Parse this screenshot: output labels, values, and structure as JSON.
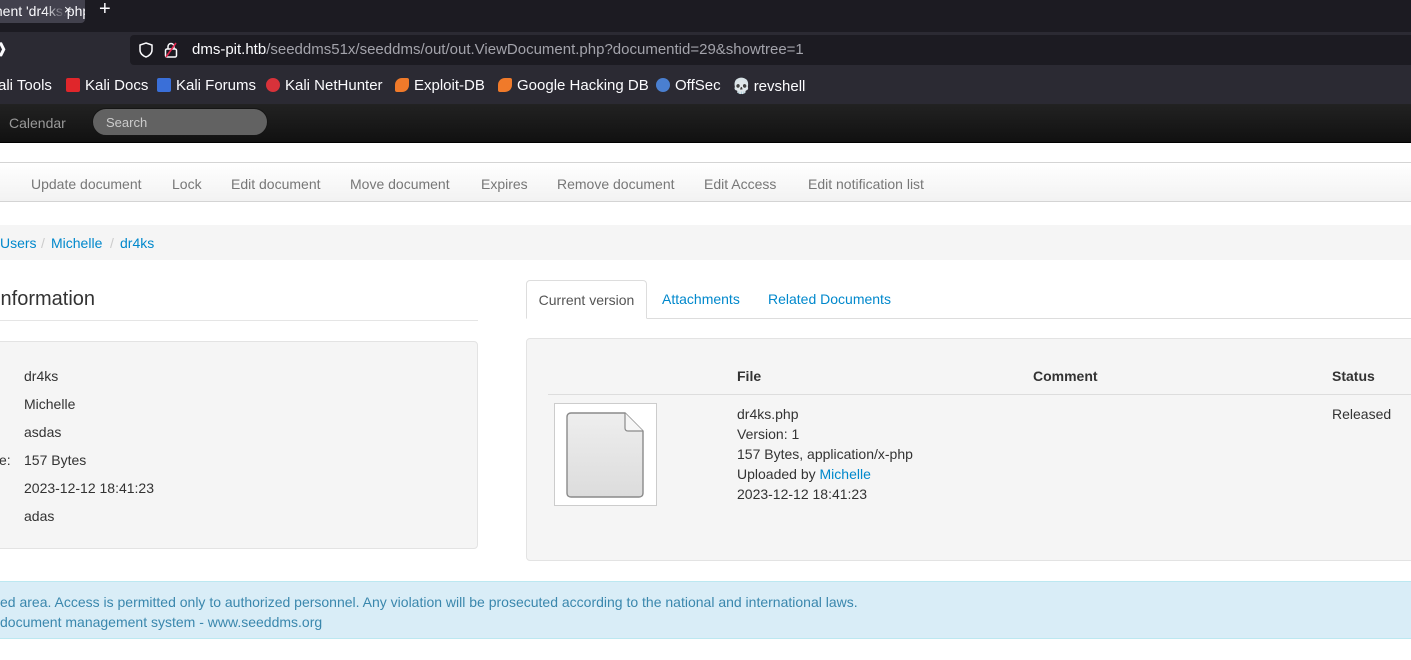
{
  "browser": {
    "tab_title": "ment 'dr4ks.php'",
    "tab_close": "×",
    "new_tab": "+",
    "url_host": "dms-pit.htb",
    "url_path": "/seeddms51x/seeddms/out/out.ViewDocument.php?documentid=29&showtree=1",
    "bookmarks": [
      {
        "label": "ali Tools",
        "icon": "kali-tools-icon",
        "color": ""
      },
      {
        "label": "Kali Docs",
        "icon": "kali-docs-icon",
        "color": "#e0262b"
      },
      {
        "label": "Kali Forums",
        "icon": "kali-forums-icon",
        "color": "#3a6fd8"
      },
      {
        "label": "Kali NetHunter",
        "icon": "nethunter-icon",
        "color": "#d8323a"
      },
      {
        "label": "Exploit-DB",
        "icon": "exploit-db-icon",
        "color": "#f07a2a"
      },
      {
        "label": "Google Hacking DB",
        "icon": "ghdb-icon",
        "color": "#f07a2a"
      },
      {
        "label": "OffSec",
        "icon": "offsec-icon",
        "color": "#4a7fd0"
      },
      {
        "label": "revshell",
        "icon": "skull-icon",
        "color": "#dddddd"
      }
    ]
  },
  "appnav": {
    "calendar": "Calendar",
    "search_placeholder": "Search"
  },
  "actions": [
    "Update document",
    "Lock",
    "Edit document",
    "Move document",
    "Expires",
    "Remove document",
    "Edit Access",
    "Edit notification list"
  ],
  "breadcrumb": [
    "Users",
    "Michelle",
    "dr4ks"
  ],
  "info": {
    "heading": "Information",
    "name": "dr4ks",
    "owner": "Michelle",
    "comment": "asdas",
    "size_label": "ce:",
    "size": "157 Bytes",
    "date": "2023-12-12 18:41:23",
    "keywords": "adas"
  },
  "tabs": [
    "Current version",
    "Attachments",
    "Related Documents"
  ],
  "version_table": {
    "headers": [
      "File",
      "Comment",
      "Status"
    ],
    "file_name": "dr4ks.php",
    "version": "Version: 1",
    "size_type": "157 Bytes, application/x-php",
    "uploaded_by_label": "Uploaded by",
    "uploaded_by": "Michelle",
    "date": "2023-12-12 18:41:23",
    "status": "Released"
  },
  "footer": {
    "line1": "ed area. Access is permitted only to authorized personnel. Any violation will be prosecuted according to the national and international laws.",
    "line2": "document management system - www.seeddms.org"
  }
}
